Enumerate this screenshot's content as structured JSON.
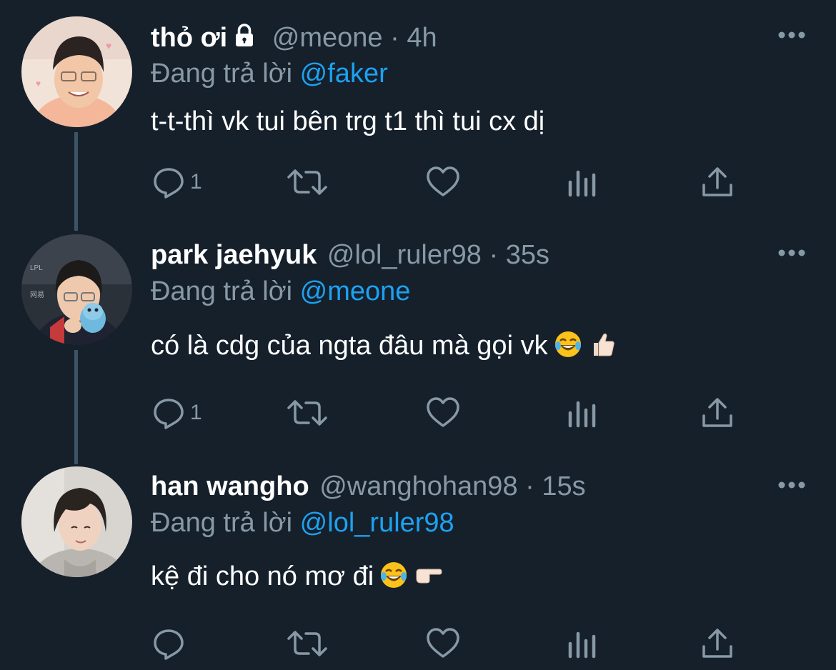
{
  "colors": {
    "background": "#15202b",
    "secondary_text": "#8899a6",
    "mention": "#1da1f2",
    "thread_line": "#3d5466"
  },
  "tweets": [
    {
      "name": "thỏ ơi",
      "protected_icon": "lock-icon",
      "handle": "@meone",
      "separator": "·",
      "time": "4h",
      "reply_prefix": "Đang trả lời",
      "reply_to": "@faker",
      "text": "t-t-thì vk tui bên trg t1 thì tui cx dị",
      "emojis": [],
      "reply_count": "1"
    },
    {
      "name": "park jaehyuk",
      "handle": "@lol_ruler98",
      "separator": "·",
      "time": "35s",
      "reply_prefix": "Đang trả lời",
      "reply_to": "@meone",
      "text": "có là cdg của ngta đâu mà gọi vk",
      "emojis": [
        "laughing-tears-emoji",
        "thumbs-up-emoji"
      ],
      "reply_count": "1"
    },
    {
      "name": "han wangho",
      "handle": "@wanghohan98",
      "separator": "·",
      "time": "15s",
      "reply_prefix": "Đang trả lời",
      "reply_to": "@lol_ruler98",
      "text": "kệ đi cho nó mơ đi",
      "emojis": [
        "laughing-tears-emoji",
        "pointing-right-emoji"
      ],
      "reply_count": ""
    }
  ],
  "action_icons": [
    "reply-icon",
    "retweet-icon",
    "like-icon",
    "analytics-icon",
    "share-icon"
  ]
}
